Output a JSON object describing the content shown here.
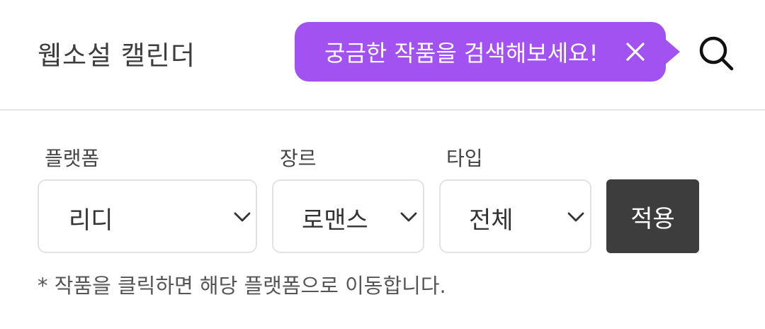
{
  "header": {
    "title": "웹소설 캘린더",
    "tooltip_text": "궁금한 작품을 검색해보세요!",
    "tooltip_color": "#a152f1",
    "close_icon": "close-icon",
    "search_icon": "search-icon"
  },
  "filters": {
    "platform": {
      "label": "플랫폼",
      "value": "리디"
    },
    "genre": {
      "label": "장르",
      "value": "로맨스"
    },
    "type": {
      "label": "타입",
      "value": "전체"
    },
    "apply_label": "적용"
  },
  "notice": "* 작품을 클릭하면 해당 플랫폼으로 이동합니다."
}
